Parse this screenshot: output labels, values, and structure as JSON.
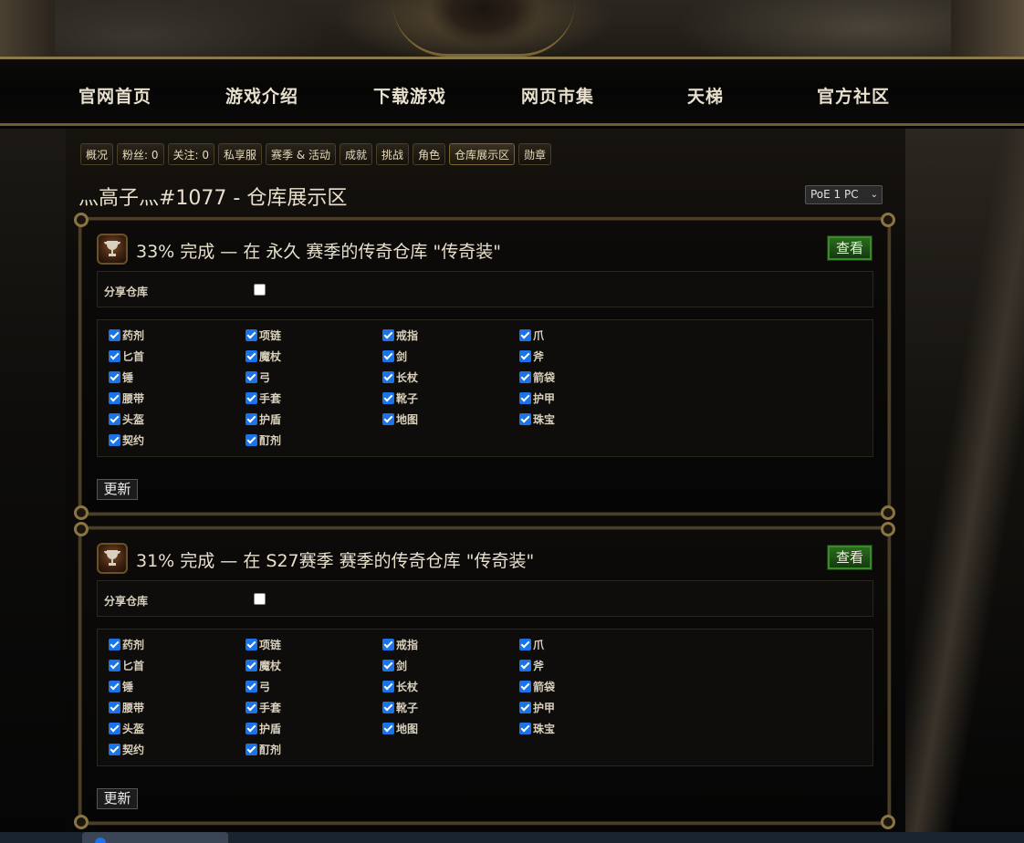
{
  "nav": {
    "items": [
      "官网首页",
      "游戏介绍",
      "下载游戏",
      "网页市集",
      "天梯",
      "官方社区"
    ]
  },
  "profile_tabs": [
    {
      "label": "概况",
      "active": false
    },
    {
      "label": "粉丝: 0",
      "active": false
    },
    {
      "label": "关注: 0",
      "active": false
    },
    {
      "label": "私享服",
      "active": false
    },
    {
      "label": "赛季 & 活动",
      "active": false
    },
    {
      "label": "成就",
      "active": false
    },
    {
      "label": "挑战",
      "active": false
    },
    {
      "label": "角色",
      "active": false
    },
    {
      "label": "仓库展示区",
      "active": true
    },
    {
      "label": "勋章",
      "active": false
    }
  ],
  "page": {
    "title": "灬高子灬#1077 - 仓库展示区",
    "realm_select": "PoE 1 PC"
  },
  "cards": [
    {
      "title": "33% 完成 — 在 永久 赛季的传奇仓库 \"传奇装\"",
      "view_label": "查看",
      "share_label": "分享仓库",
      "share_checked": false,
      "update_label": "更新",
      "filters": [
        {
          "label": "药剂",
          "checked": true
        },
        {
          "label": "项链",
          "checked": true
        },
        {
          "label": "戒指",
          "checked": true
        },
        {
          "label": "爪",
          "checked": true
        },
        {
          "label": "匕首",
          "checked": true
        },
        {
          "label": "魔杖",
          "checked": true
        },
        {
          "label": "剑",
          "checked": true
        },
        {
          "label": "斧",
          "checked": true
        },
        {
          "label": "锤",
          "checked": true
        },
        {
          "label": "弓",
          "checked": true
        },
        {
          "label": "长杖",
          "checked": true
        },
        {
          "label": "箭袋",
          "checked": true
        },
        {
          "label": "腰带",
          "checked": true
        },
        {
          "label": "手套",
          "checked": true
        },
        {
          "label": "靴子",
          "checked": true
        },
        {
          "label": "护甲",
          "checked": true
        },
        {
          "label": "头盔",
          "checked": true
        },
        {
          "label": "护盾",
          "checked": true
        },
        {
          "label": "地图",
          "checked": true
        },
        {
          "label": "珠宝",
          "checked": true
        },
        {
          "label": "契约",
          "checked": true
        },
        {
          "label": "酊剂",
          "checked": true
        }
      ]
    },
    {
      "title": "31% 完成 — 在 S27赛季 赛季的传奇仓库 \"传奇装\"",
      "view_label": "查看",
      "share_label": "分享仓库",
      "share_checked": false,
      "update_label": "更新",
      "filters": [
        {
          "label": "药剂",
          "checked": true
        },
        {
          "label": "项链",
          "checked": true
        },
        {
          "label": "戒指",
          "checked": true
        },
        {
          "label": "爪",
          "checked": true
        },
        {
          "label": "匕首",
          "checked": true
        },
        {
          "label": "魔杖",
          "checked": true
        },
        {
          "label": "剑",
          "checked": true
        },
        {
          "label": "斧",
          "checked": true
        },
        {
          "label": "锤",
          "checked": true
        },
        {
          "label": "弓",
          "checked": true
        },
        {
          "label": "长杖",
          "checked": true
        },
        {
          "label": "箭袋",
          "checked": true
        },
        {
          "label": "腰带",
          "checked": true
        },
        {
          "label": "手套",
          "checked": true
        },
        {
          "label": "靴子",
          "checked": true
        },
        {
          "label": "护甲",
          "checked": true
        },
        {
          "label": "头盔",
          "checked": true
        },
        {
          "label": "护盾",
          "checked": true
        },
        {
          "label": "地图",
          "checked": true
        },
        {
          "label": "珠宝",
          "checked": true
        },
        {
          "label": "契约",
          "checked": true
        },
        {
          "label": "酊剂",
          "checked": true
        }
      ]
    }
  ]
}
